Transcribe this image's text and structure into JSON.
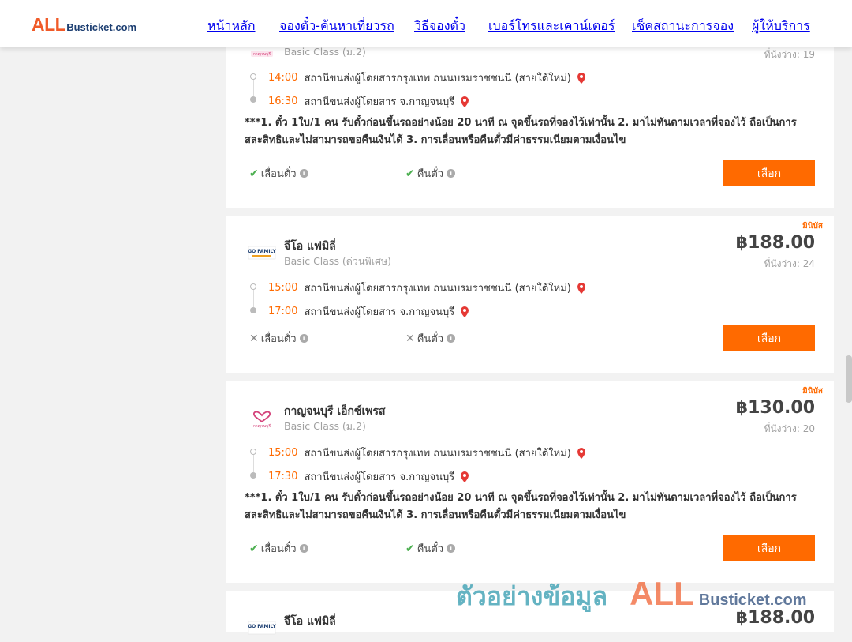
{
  "header": {
    "logo_all": "ALL",
    "logo_rest": "Busticket.com",
    "nav": [
      "หน้าหลัก",
      "จองตั๋ว-ค้นหาเที่ยวรถ",
      "วิธีจองตั๋ว",
      "เบอร์โทรและเคาน์เตอร์",
      "เช็คสถานะการจอง",
      "ผู้ให้บริการ"
    ]
  },
  "trips": [
    {
      "class": "Basic Class (ม.2)",
      "seats": "ที่นั่งว่าง: 19",
      "dep_time": "14:00",
      "dep_station": "สถานีขนส่งผู้โดยสารกรุงเทพ ถนนบรมราชชนนี (สายใต้ใหม่)",
      "arr_time": "16:30",
      "arr_station": "สถานีขนส่งผู้โดยสาร จ.กาญจนบุรี",
      "note": "***1. ตั๋ว 1ใบ/1 คน รับตั๋วก่อนขึ้นรถอย่างน้อย 20 นาที ณ จุดขึ้นรถที่จองไว้เท่านั้น 2. มาไม่ทันตามเวลาที่จองไว้ ถือเป็นการสละสิทธิและไม่สามารถขอคืนเงินได้ 3. การเลื่อนหรือคืนตั๋วมีค่าธรรมเนียมตามเงื่อนไข",
      "reschedule": "เลื่อนตั๋ว",
      "refund": "คืนตั๋ว",
      "select": "เลือก"
    },
    {
      "bus_type": "มินิบัส",
      "operator": "จีโอ แฟมิลี่",
      "class": "Basic Class (ด่วนพิเศษ)",
      "price": "฿188.00",
      "seats": "ที่นั่งว่าง: 24",
      "dep_time": "15:00",
      "dep_station": "สถานีขนส่งผู้โดยสารกรุงเทพ ถนนบรมราชชนนี (สายใต้ใหม่)",
      "arr_time": "17:00",
      "arr_station": "สถานีขนส่งผู้โดยสาร จ.กาญจนบุรี",
      "reschedule": "เลื่อนตั๋ว",
      "refund": "คืนตั๋ว",
      "select": "เลือก"
    },
    {
      "bus_type": "มินิบัส",
      "operator": "กาญจนบุรี เอ็กซ์เพรส",
      "class": "Basic Class (ม.2)",
      "price": "฿130.00",
      "seats": "ที่นั่งว่าง: 20",
      "dep_time": "15:00",
      "dep_station": "สถานีขนส่งผู้โดยสารกรุงเทพ ถนนบรมราชชนนี (สายใต้ใหม่)",
      "arr_time": "17:30",
      "arr_station": "สถานีขนส่งผู้โดยสาร จ.กาญจนบุรี",
      "note": "***1. ตั๋ว 1ใบ/1 คน รับตั๋วก่อนขึ้นรถอย่างน้อย 20 นาที ณ จุดขึ้นรถที่จองไว้เท่านั้น 2. มาไม่ทันตามเวลาที่จองไว้ ถือเป็นการสละสิทธิและไม่สามารถขอคืนเงินได้ 3. การเลื่อนหรือคืนตั๋วมีค่าธรรมเนียมตามเงื่อนไข",
      "reschedule": "เลื่อนตั๋ว",
      "refund": "คืนตั๋ว",
      "select": "เลือก"
    },
    {
      "operator": "จีโอ แฟมิลี่",
      "price": "฿188.00"
    }
  ],
  "watermark": {
    "thai": "ตัวอย่างข้อมูล",
    "all": "ALL",
    "rest": "Busticket.com"
  },
  "colors": {
    "accent": "#ff6a00",
    "brand_orange": "#f05a28",
    "brand_navy": "#1d3f72",
    "ok_green": "#4caf50"
  },
  "icons": {
    "pin": "map-pin-icon",
    "ok": "check-icon",
    "no": "cross-icon",
    "info": "info-icon"
  }
}
